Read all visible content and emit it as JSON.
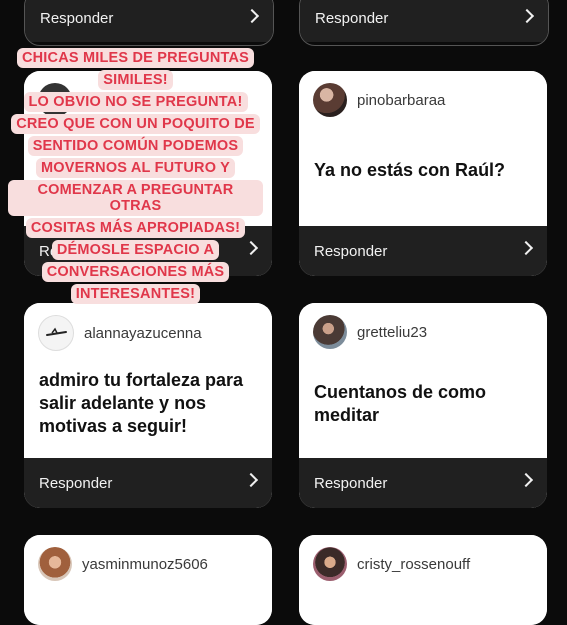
{
  "reply_label": "Responder",
  "colors": {
    "background": "#0b0b0b",
    "card": "#ffffff",
    "reply_bar": "#202020",
    "overlay_text": "#e0374a",
    "overlay_bg": "#f8dede"
  },
  "overlay_text": [
    "CHICAS MILES DE PREGUNTAS",
    "SIMILES!",
    "LO OBVIO NO SE PREGUNTA!",
    "CREO QUE CON UN POQUITO DE",
    "SENTIDO COMÚN PODEMOS",
    "MOVERNOS AL FUTURO Y",
    "COMENZAR A PREGUNTAR OTRAS",
    "COSITAS MÁS APROPIADAS!",
    "DÉMOSLE ESPACIO A",
    "CONVERSACIONES MÁS",
    "INTERESANTES!"
  ],
  "cards": [
    {
      "username": "",
      "question": ""
    },
    {
      "username": "",
      "question": ""
    },
    {
      "username": "",
      "question": ""
    },
    {
      "username": "pinobarbaraa",
      "question": "Ya no estás con Raúl?"
    },
    {
      "username": "alannayazucenna",
      "question": "admiro tu fortaleza para salir adelante y nos motivas a seguir!"
    },
    {
      "username": "gretteliu23",
      "question": "Cuentanos de como meditar"
    },
    {
      "username": "yasminmunoz5606",
      "question": ""
    },
    {
      "username": "cristy_rossenouff",
      "question": ""
    }
  ]
}
